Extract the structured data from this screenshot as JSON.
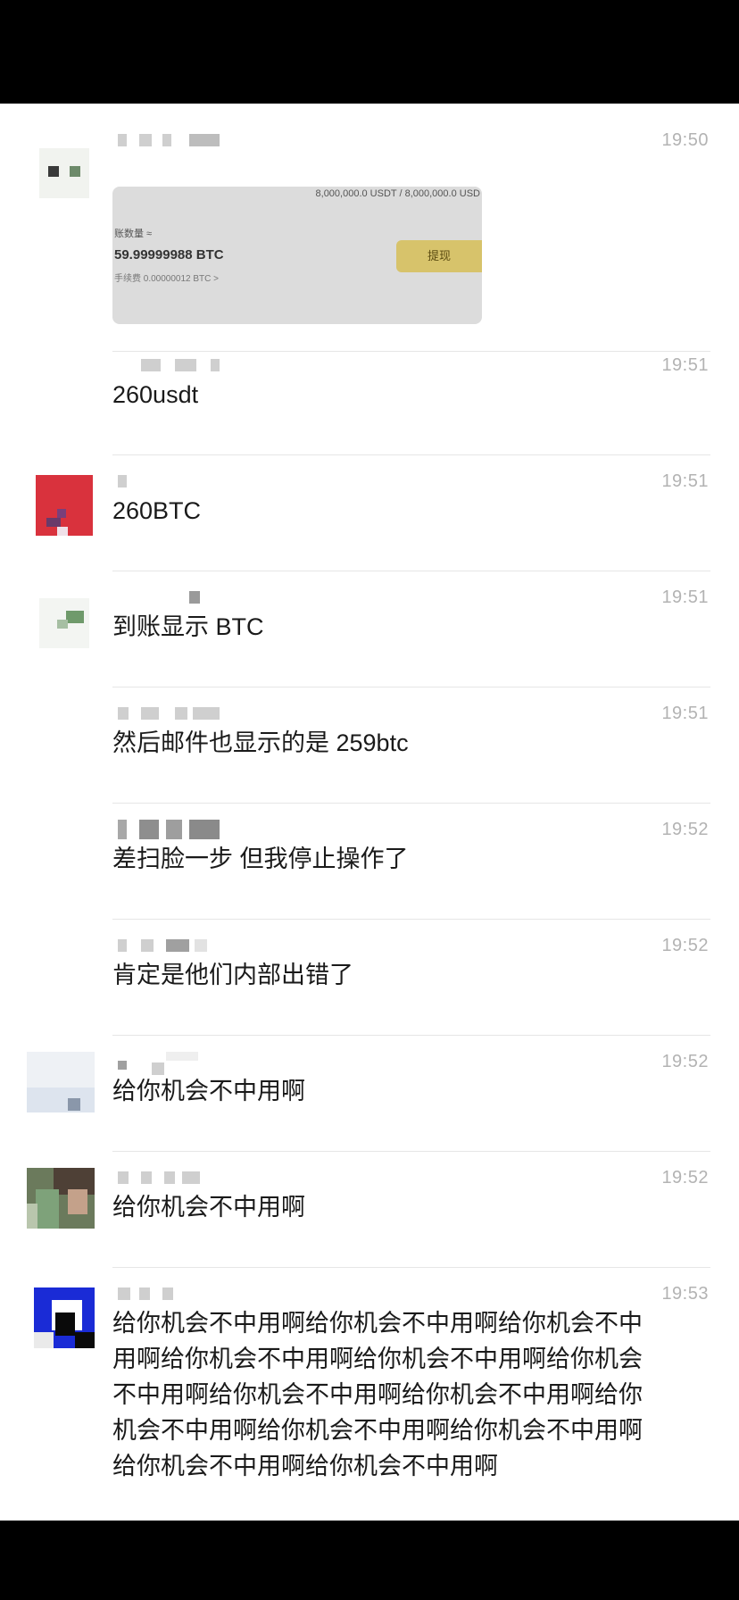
{
  "messages": [
    {
      "time": "19:50",
      "type": "image",
      "image": {
        "limit": "8,000,000.0 USDT / 8,000,000.0 USD",
        "amount_label": "账数量 ≈",
        "amount": "59.99999988 BTC",
        "fee": "手续费 0.00000012 BTC >",
        "withdraw_button": "提现"
      }
    },
    {
      "time": "19:51",
      "text": "260usdt"
    },
    {
      "time": "19:51",
      "text": "260BTC"
    },
    {
      "time": "19:51",
      "text": "到账显示 BTC"
    },
    {
      "time": "19:51",
      "text": "然后邮件也显示的是 259btc"
    },
    {
      "time": "19:52",
      "text": "差扫脸一步 但我停止操作了"
    },
    {
      "time": "19:52",
      "text": "肯定是他们内部出错了"
    },
    {
      "time": "19:52",
      "text": "给你机会不中用啊"
    },
    {
      "time": "19:52",
      "text": "给你机会不中用啊"
    },
    {
      "time": "19:53",
      "text_lines": [
        "给你机会不中用啊给你机会不中用啊给你机会不中",
        "用啊给你机会不中用啊给你机会不中用啊给你机会",
        "不中用啊给你机会不中用啊给你机会不中用啊给你",
        "机会不中用啊给你机会不中用啊给你机会不中用啊",
        "给你机会不中用啊给你机会不中用啊"
      ]
    }
  ]
}
